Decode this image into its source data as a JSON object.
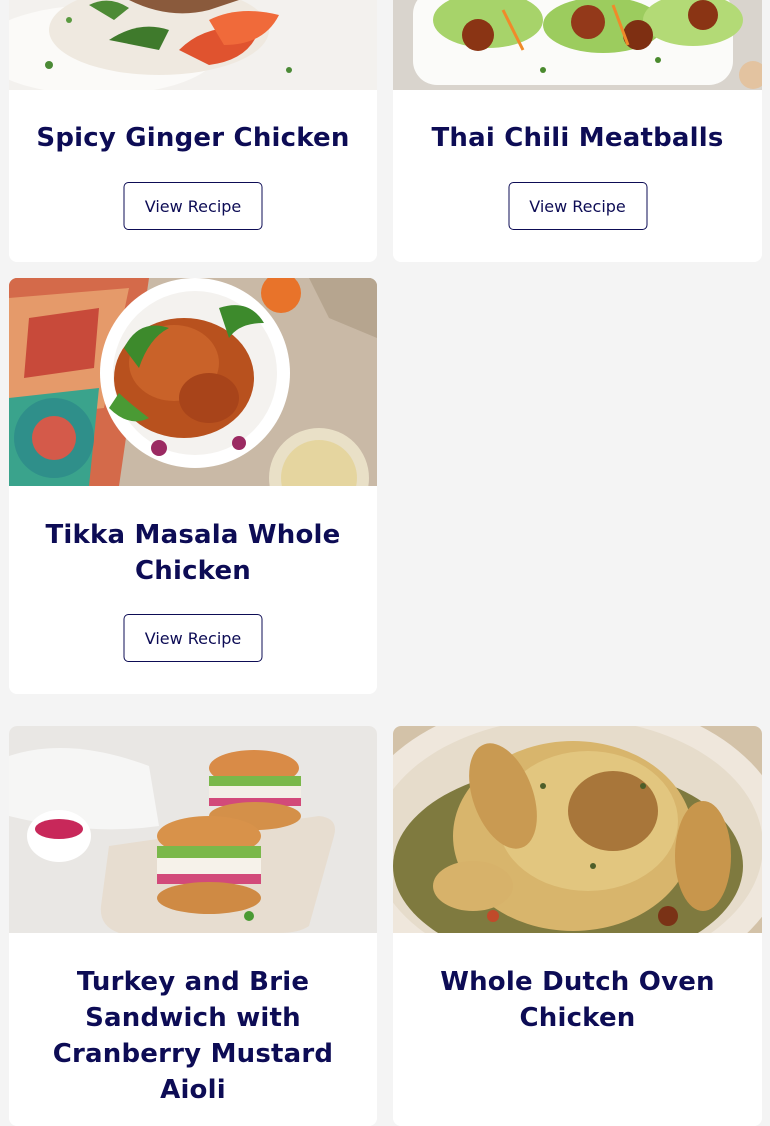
{
  "recipes": [
    {
      "title": "Spicy Ginger Chicken",
      "button_label": "View Recipe"
    },
    {
      "title": "Thai Chili Meatballs",
      "button_label": "View Recipe"
    },
    {
      "title": "Tikka Masala Whole Chicken",
      "button_label": "View Recipe"
    },
    {
      "title": "Turkey and Brie Sandwich with Cranberry Mustard Aioli"
    },
    {
      "title": "Whole Dutch Oven Chicken"
    }
  ],
  "colors": {
    "page_background": "#f4f4f4",
    "card_background": "#ffffff",
    "brand_navy": "#0d0c55"
  }
}
